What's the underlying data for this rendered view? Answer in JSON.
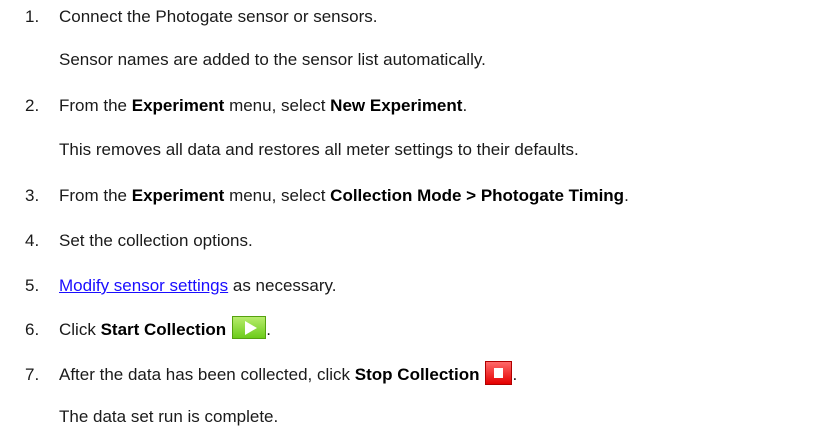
{
  "steps": [
    {
      "num": "1.",
      "text": "Connect the Photogate sensor or sensors.",
      "note": "Sensor names are added to the sensor list automatically."
    },
    {
      "num": "2.",
      "t1": "From the ",
      "b1": "Experiment",
      "t2": " menu, select ",
      "b2": "New Experiment",
      "t3": ".",
      "note": "This removes all data and restores all meter settings to their defaults."
    },
    {
      "num": "3.",
      "t1": "From the ",
      "b1": "Experiment",
      "t2": " menu, select ",
      "b2": "Collection Mode > Photogate Timing",
      "t3": "."
    },
    {
      "num": "4.",
      "text": "Set the collection options."
    },
    {
      "num": "5.",
      "link": "Modify sensor settings",
      "t1": " as necessary."
    },
    {
      "num": "6.",
      "t1": "Click ",
      "b1": "Start Collection",
      "t2": ".",
      "icon": "start-collection-play-icon"
    },
    {
      "num": "7.",
      "t1": "After the data has been collected, click ",
      "b1": "Stop Collection",
      "t2": ".",
      "icon": "stop-collection-stop-icon",
      "note": "The data set run is complete."
    }
  ],
  "colors": {
    "link": "#1a0dff",
    "start_button": "#6ccc1a",
    "stop_button": "#e40000"
  }
}
